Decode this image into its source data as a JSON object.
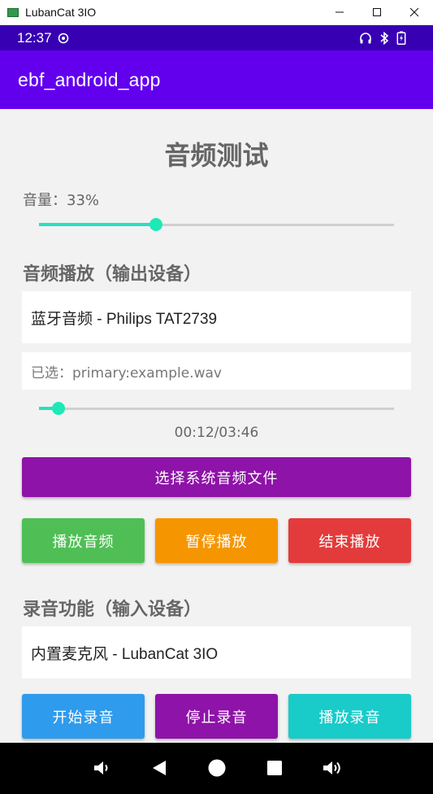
{
  "window": {
    "title": "LubanCat 3IO"
  },
  "status": {
    "time": "12:37"
  },
  "appbar": {
    "title": "ebf_android_app"
  },
  "page": {
    "title": "音频测试"
  },
  "volume": {
    "label": "音量：33%",
    "level": 0.33
  },
  "playback": {
    "section": "音频播放（输出设备）",
    "device": "蓝牙音频 - Philips TAT2739",
    "selected_file": "已选：primary:example.wav",
    "progress": 0.055,
    "time": "00:12/03:46",
    "choose_button": "选择系统音频文件",
    "play_button": "播放音频",
    "pause_button": "暂停播放",
    "stop_button": "结束播放"
  },
  "recording": {
    "section": "录音功能（输入设备）",
    "device": "内置麦克风 - LubanCat 3IO",
    "start_button": "开始录音",
    "stop_button": "停止录音",
    "play_button": "播放录音"
  },
  "colors": {
    "appbar": "#6200ee",
    "statusbar": "#3700b3",
    "accent": "#1de9b6",
    "choose": "#8e13a8",
    "play": "#4fbf55",
    "pause": "#f59600",
    "stop": "#e33b3b",
    "rec_start": "#2f9bec",
    "rec_stop": "#8e13a8",
    "rec_play": "#19cbc9"
  },
  "icons": {
    "status_left": "settings-circle-icon",
    "status_right": [
      "headset-icon",
      "bluetooth-icon",
      "battery-charging-icon"
    ],
    "nav": [
      "volume-down-icon",
      "back-icon",
      "home-icon",
      "recents-icon",
      "volume-up-icon"
    ]
  }
}
